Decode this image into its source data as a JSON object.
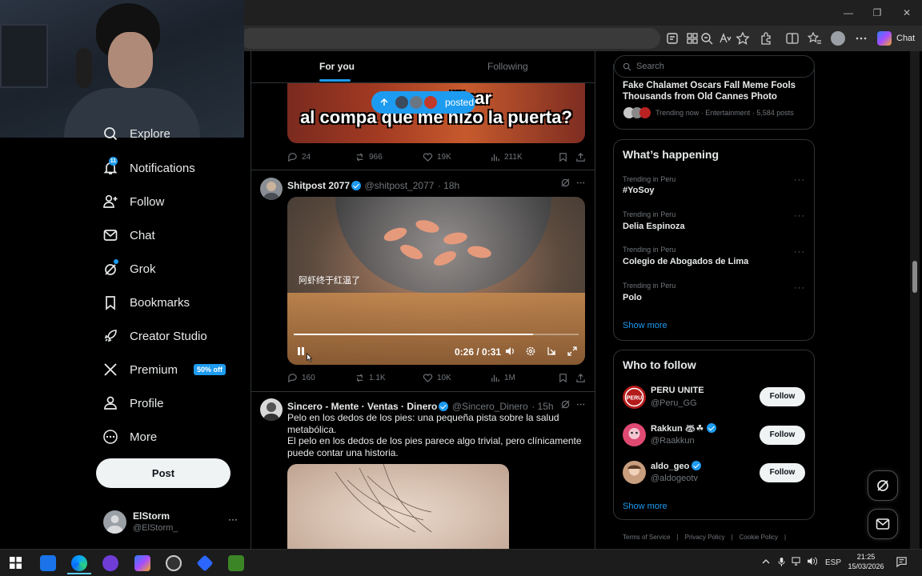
{
  "browser": {
    "chat_label": "Chat",
    "controls": {
      "minimize": "—",
      "restore": "❐",
      "close": "✕"
    }
  },
  "sidebar": {
    "items": [
      {
        "label": "Explore",
        "icon": "search-icon"
      },
      {
        "label": "Notifications",
        "icon": "bell-icon",
        "badge": "11"
      },
      {
        "label": "Follow",
        "icon": "person-plus-icon"
      },
      {
        "label": "Chat",
        "icon": "envelope-icon"
      },
      {
        "label": "Grok",
        "icon": "grok-icon"
      },
      {
        "label": "Bookmarks",
        "icon": "bookmark-icon"
      },
      {
        "label": "Creator Studio",
        "icon": "rocket-icon"
      },
      {
        "label": "Premium",
        "icon": "x-logo-icon",
        "badge": "50% off"
      },
      {
        "label": "Profile",
        "icon": "person-icon"
      },
      {
        "label": "More",
        "icon": "more-circle-icon"
      }
    ],
    "post_button": "Post",
    "user": {
      "name": "ElStorm",
      "handle": "@ElStorm_",
      "more": "···"
    }
  },
  "feed": {
    "tabs": {
      "active": "For you",
      "inactive": "Following"
    },
    "posted_pill": "posted",
    "meme_lines": [
      "por c           ucificar",
      "al compa que me hizo la puerta?"
    ],
    "post1_actions": {
      "replies": "24",
      "reposts": "966",
      "likes": "19K",
      "views": "211K"
    },
    "post2": {
      "name": "Shitpost 2077",
      "handle": "@shitpost_2077",
      "time": "· 18h",
      "video_subtitle": "阿虾终于红温了",
      "video_time": "0:26 / 0:31",
      "video_progress": 0.84,
      "actions": {
        "replies": "160",
        "reposts": "1.1K",
        "likes": "10K",
        "views": "1M"
      }
    },
    "post3": {
      "name": "Sincero - Mente · Ventas · Dinero",
      "handle": "@Sincero_Dinero",
      "time": "· 15h",
      "text1": "Pelo en los dedos de los pies: una pequeña pista sobre la salud metabólica.",
      "text2": "El pelo en los dedos de los pies parece algo trivial, pero clínicamente puede contar una historia."
    }
  },
  "right": {
    "search_placeholder": "Search",
    "top_trend": {
      "title": "Fake Chalamet Oscars Fall Meme Fools Thousands from Old Cannes Photo",
      "meta": "Trending now · Entertainment · 5,584 posts"
    },
    "whats_happening": {
      "title": "What’s happening",
      "trends": [
        {
          "meta": "Trending in Peru",
          "name": "#YoSoy"
        },
        {
          "meta": "Trending in Peru",
          "name": "Delia Espinoza"
        },
        {
          "meta": "Trending in Peru",
          "name": "Colegio de Abogados de Lima"
        },
        {
          "meta": "Trending in Peru",
          "name": "Polo"
        }
      ],
      "show_more": "Show more",
      "dots": "···"
    },
    "who_to_follow": {
      "title": "Who to follow",
      "accounts": [
        {
          "name": "PERU UNITE",
          "handle": "@Peru_GG",
          "button": "Follow"
        },
        {
          "name": "Rakkun 🦝☘",
          "handle": "@Raakkun",
          "button": "Follow"
        },
        {
          "name": "aldo_geo",
          "handle": "@aldogeotv",
          "button": "Follow"
        }
      ],
      "show_more": "Show more"
    },
    "footer": [
      "Terms of Service",
      "|",
      "Privacy Policy",
      "|",
      "Cookie Policy",
      "|"
    ]
  },
  "taskbar": {
    "lang": "ESP",
    "time": "21:25",
    "date": "15/03/2026"
  }
}
